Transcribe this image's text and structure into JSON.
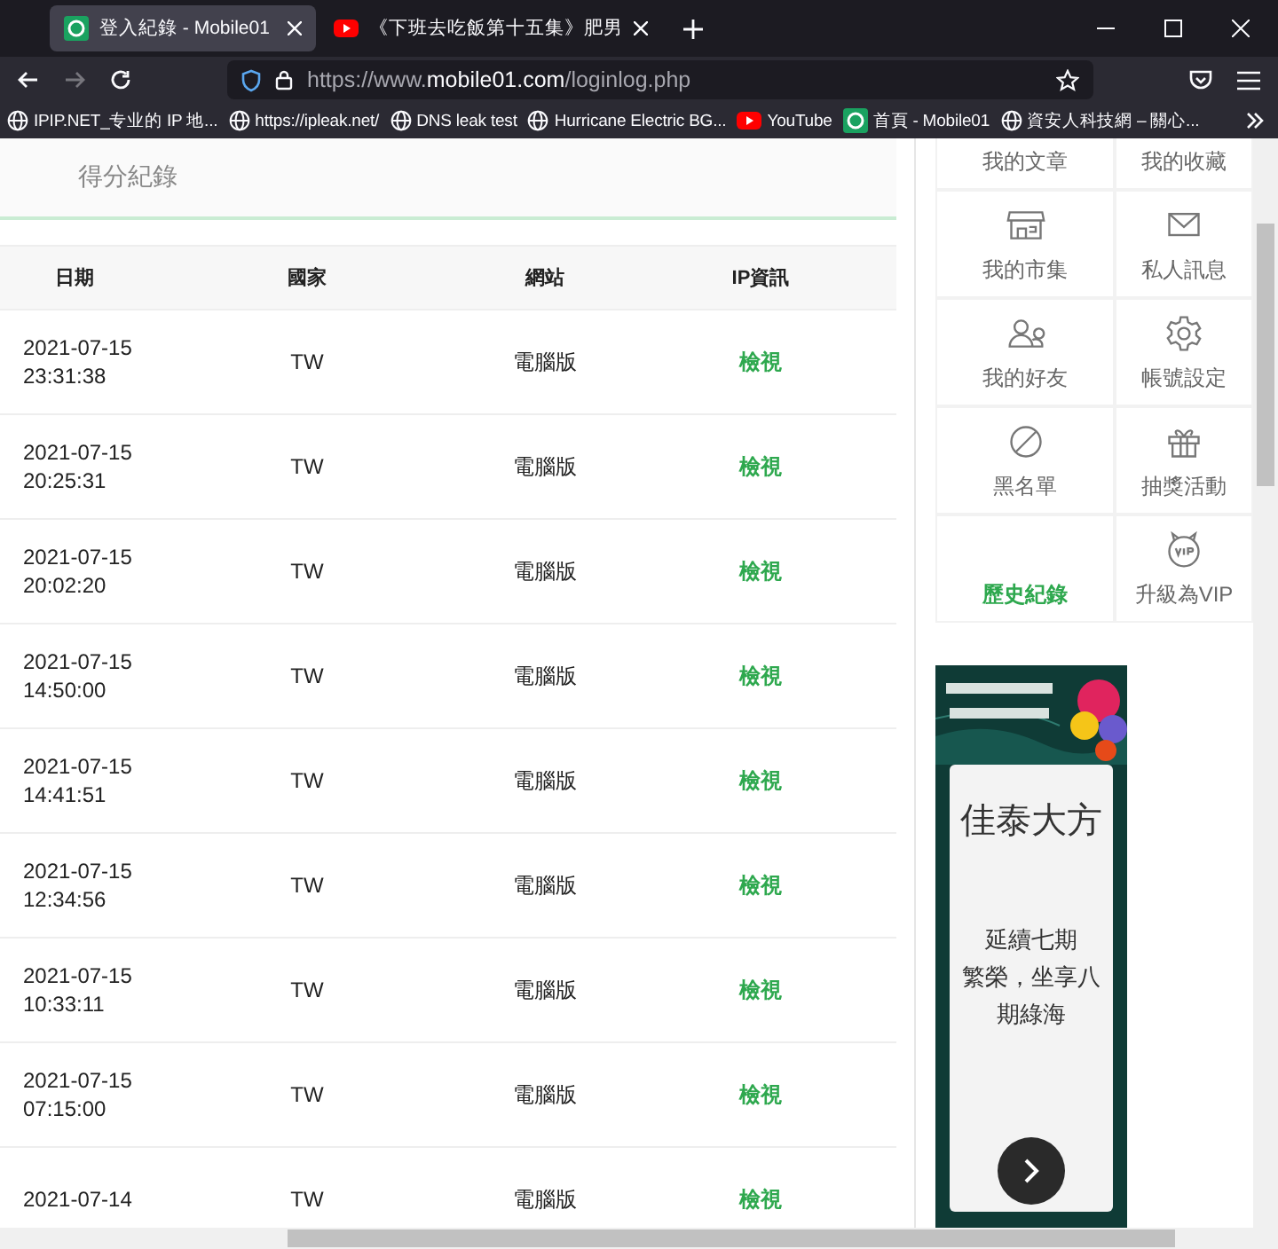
{
  "browser": {
    "tabs": [
      {
        "title": "登入紀錄 - Mobile01",
        "kind": "mobile01",
        "selected": true
      },
      {
        "title": "《下班去吃飯第十五集》肥男",
        "kind": "youtube",
        "selected": false
      }
    ],
    "url_prefix": "https://www.",
    "url_host": "mobile01.com",
    "url_path": "/loginlog.php",
    "bookmarks": [
      {
        "label": "IPIP.NET_专业的 IP 地...",
        "kind": "globe"
      },
      {
        "label": "https://ipleak.net/",
        "kind": "globe"
      },
      {
        "label": "DNS leak test",
        "kind": "globe"
      },
      {
        "label": "Hurricane Electric BG...",
        "kind": "globe"
      },
      {
        "label": "YouTube",
        "kind": "youtube"
      },
      {
        "label": "首頁 - Mobile01",
        "kind": "mobile01"
      },
      {
        "label": "資安人科技網 – 關心...",
        "kind": "globe"
      }
    ]
  },
  "section_tab": "得分紀錄",
  "table": {
    "columns": [
      "日期",
      "國家",
      "網站",
      "IP資訊"
    ],
    "rows": [
      {
        "date": "2021-07-15",
        "time": "23:31:38",
        "country": "TW",
        "site": "電腦版",
        "ip": "檢視"
      },
      {
        "date": "2021-07-15",
        "time": "20:25:31",
        "country": "TW",
        "site": "電腦版",
        "ip": "檢視"
      },
      {
        "date": "2021-07-15",
        "time": "20:02:20",
        "country": "TW",
        "site": "電腦版",
        "ip": "檢視"
      },
      {
        "date": "2021-07-15",
        "time": "14:50:00",
        "country": "TW",
        "site": "電腦版",
        "ip": "檢視"
      },
      {
        "date": "2021-07-15",
        "time": "14:41:51",
        "country": "TW",
        "site": "電腦版",
        "ip": "檢視"
      },
      {
        "date": "2021-07-15",
        "time": "12:34:56",
        "country": "TW",
        "site": "電腦版",
        "ip": "檢視"
      },
      {
        "date": "2021-07-15",
        "time": "10:33:11",
        "country": "TW",
        "site": "電腦版",
        "ip": "檢視"
      },
      {
        "date": "2021-07-15",
        "time": "07:15:00",
        "country": "TW",
        "site": "電腦版",
        "ip": "檢視"
      },
      {
        "date": "2021-07-14",
        "country": "TW",
        "site": "電腦版",
        "ip": "檢視"
      }
    ]
  },
  "sidebar": {
    "items": [
      {
        "label": "我的文章",
        "kind": "plain",
        "selected": false
      },
      {
        "label": "我的收藏",
        "kind": "plain",
        "selected": false
      },
      {
        "label": "我的市集",
        "kind": "store",
        "selected": false
      },
      {
        "label": "私人訊息",
        "kind": "mail",
        "selected": false
      },
      {
        "label": "我的好友",
        "kind": "friends",
        "selected": false
      },
      {
        "label": "帳號設定",
        "kind": "gear",
        "selected": false
      },
      {
        "label": "黑名單",
        "kind": "block",
        "selected": false
      },
      {
        "label": "抽獎活動",
        "kind": "gift",
        "selected": false
      },
      {
        "label": "歷史紀錄",
        "kind": "plain",
        "selected": true
      },
      {
        "label": "升級為VIP",
        "kind": "vip",
        "selected": false
      }
    ]
  },
  "ad": {
    "title": "佳泰大方",
    "body_lines": [
      "延續七期",
      "繁榮，坐享八",
      "期綠海"
    ],
    "banner": {
      "kind": "picture"
    }
  }
}
